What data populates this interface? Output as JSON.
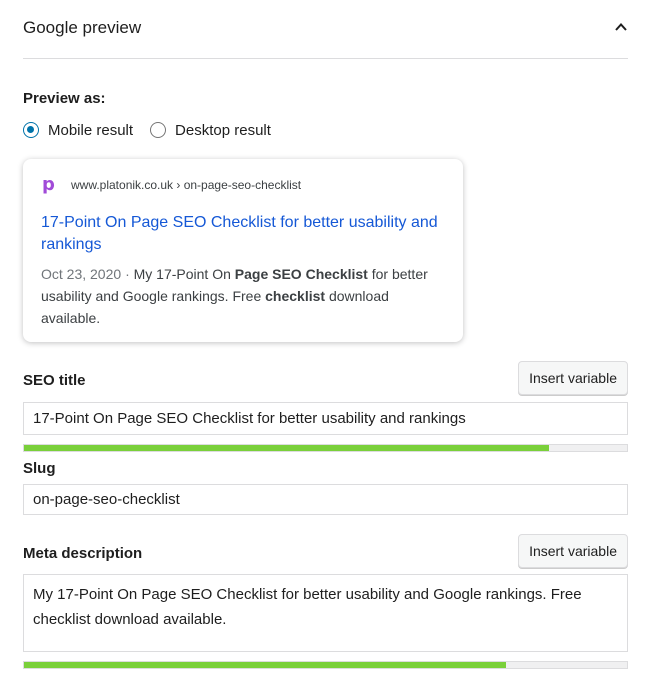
{
  "panel": {
    "title": "Google preview"
  },
  "preview": {
    "label": "Preview as:",
    "options": [
      {
        "label": "Mobile result",
        "checked": true
      },
      {
        "label": "Desktop result",
        "checked": false
      }
    ]
  },
  "serp": {
    "favicon_letter": "p",
    "url": "www.platonik.co.uk › on-page-seo-checklist",
    "title": "17-Point On Page SEO Checklist for better usability and rankings",
    "date": "Oct 23, 2020",
    "separator": "·",
    "snippet_parts": [
      {
        "text": "My 17-Point On ",
        "bold": false
      },
      {
        "text": "Page SEO Checklist",
        "bold": true
      },
      {
        "text": " for better usability and Google rankings. Free ",
        "bold": false
      },
      {
        "text": "checklist",
        "bold": true
      },
      {
        "text": " download available.",
        "bold": false
      }
    ]
  },
  "seo_title": {
    "label": "SEO title",
    "insert_label": "Insert variable",
    "value": "17-Point On Page SEO Checklist for better usability and rankings",
    "progress": 0.87
  },
  "slug": {
    "label": "Slug",
    "value": "on-page-seo-checklist"
  },
  "meta": {
    "label": "Meta description",
    "insert_label": "Insert variable",
    "value": "My 17-Point On Page SEO Checklist for better usability and Google rankings. Free checklist download available.",
    "progress": 0.8
  },
  "colors": {
    "accent": "#0073aa",
    "link": "#1558d6",
    "progress_good": "#7ad03a",
    "favicon": "#a14bd8"
  }
}
